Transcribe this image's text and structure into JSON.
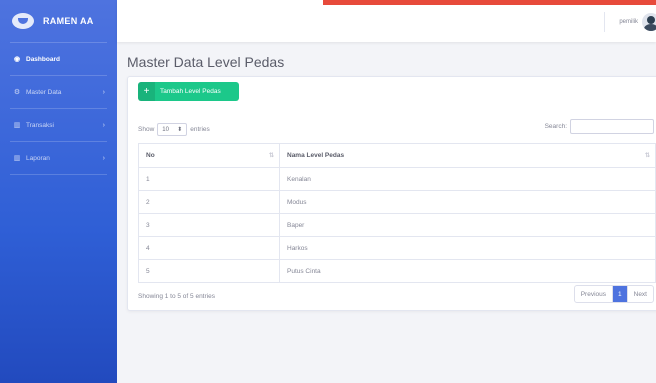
{
  "brand": {
    "name": "RAMEN AA"
  },
  "sidebar": {
    "items": [
      {
        "label": "Dashboard",
        "icon": "speedometer-icon",
        "glyph": "◉",
        "chevron": ""
      },
      {
        "label": "Master Data",
        "icon": "gear-icon",
        "glyph": "⚙",
        "chevron": "›"
      },
      {
        "label": "Transaksi",
        "icon": "chart-icon",
        "glyph": "▥",
        "chevron": "›"
      },
      {
        "label": "Laporan",
        "icon": "chart-icon",
        "glyph": "▥",
        "chevron": "›"
      }
    ]
  },
  "topbar": {
    "username": "pemilik"
  },
  "page": {
    "title": "Master Data Level Pedas"
  },
  "toolbar": {
    "add_label": "Tambah Level Pedas",
    "add_icon": "+"
  },
  "datatable": {
    "show_prefix": "Show",
    "length_value": "10",
    "show_suffix": "entries",
    "search_label": "Search:",
    "columns": [
      "No",
      "Nama Level Pedas"
    ],
    "rows": [
      {
        "no": "1",
        "name": "Kenalan"
      },
      {
        "no": "2",
        "name": "Modus"
      },
      {
        "no": "3",
        "name": "Baper"
      },
      {
        "no": "4",
        "name": "Harkos"
      },
      {
        "no": "5",
        "name": "Putus Cinta"
      }
    ],
    "info": "Showing 1 to 5 of 5 entries",
    "pagination": {
      "previous": "Previous",
      "current": "1",
      "next": "Next"
    }
  },
  "colors": {
    "primary": "#4e73df",
    "success": "#1cc88a",
    "danger": "#e74a3b"
  }
}
